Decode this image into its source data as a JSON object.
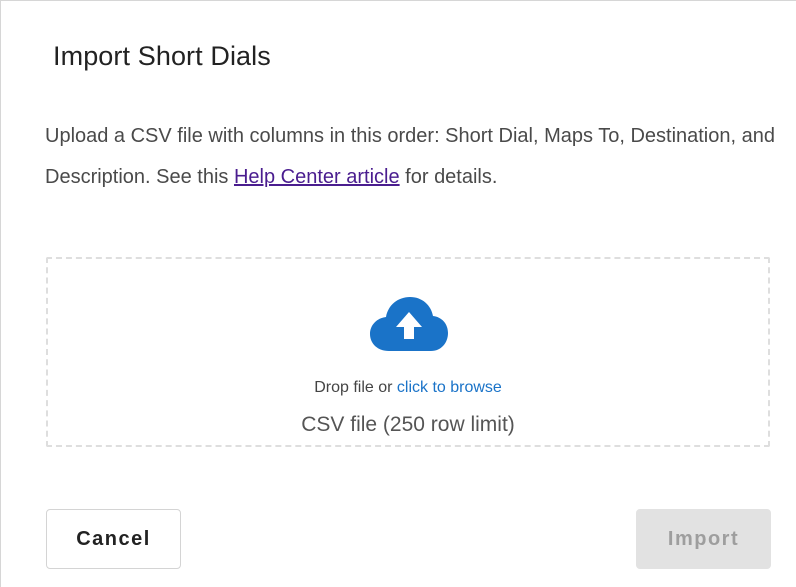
{
  "dialog": {
    "title": "Import Short Dials",
    "description_before": "Upload a CSV file with columns in this order: Short Dial, Maps To, Destination, and Description. See this ",
    "help_link_text": "Help Center article",
    "description_after": " for details."
  },
  "dropzone": {
    "icon": "cloud-upload-icon",
    "drop_text": "Drop file or ",
    "browse_text": "click to browse",
    "hint": "CSV file (250 row limit)"
  },
  "footer": {
    "cancel_label": "Cancel",
    "import_label": "Import"
  },
  "colors": {
    "accent": "#1a73c8",
    "link": "#4a1d8f",
    "disabled_bg": "#e2e2e2",
    "disabled_text": "#9e9e9e"
  }
}
